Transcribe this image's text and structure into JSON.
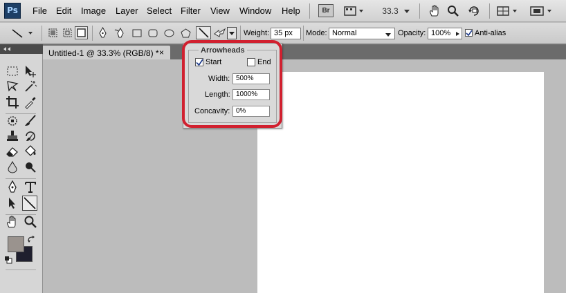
{
  "app": {
    "logo_text": "Ps"
  },
  "menu": {
    "items": [
      "File",
      "Edit",
      "Image",
      "Layer",
      "Select",
      "Filter",
      "View",
      "Window",
      "Help"
    ],
    "bridge_label": "Br",
    "zoom_value": "33.3"
  },
  "options": {
    "weight_label": "Weight:",
    "weight_value": "35 px",
    "mode_label": "Mode:",
    "mode_value": "Normal",
    "opacity_label": "Opacity:",
    "opacity_value": "100%",
    "antialias_label": "Anti-alias",
    "antialias_checked": true
  },
  "document_tab": {
    "title": "Untitled-1 @ 33.3% (RGB/8) *",
    "close": "×"
  },
  "arrowheads": {
    "title": "Arrowheads",
    "start_label": "Start",
    "start_checked": true,
    "end_label": "End",
    "end_checked": false,
    "width_label": "Width:",
    "width_value": "500%",
    "length_label": "Length:",
    "length_value": "1000%",
    "concavity_label": "Concavity:",
    "concavity_value": "0%"
  },
  "colors": {
    "foreground": "#9a938e",
    "background": "#1f1f2e",
    "highlight": "#d1202f"
  }
}
